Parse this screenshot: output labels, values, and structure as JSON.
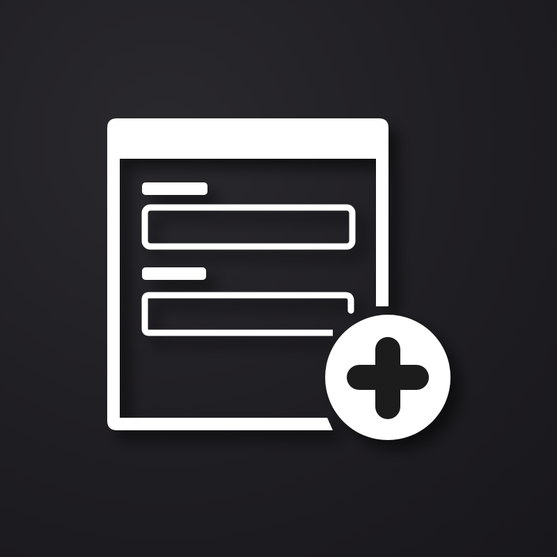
{
  "icon": {
    "name": "add-form-icon",
    "description_icons": [
      "form-document-icon",
      "plus-circle-icon"
    ]
  },
  "colors": {
    "background": "#1f1e22",
    "foreground": "#ffffff",
    "shadow": "#0c0c0e"
  }
}
